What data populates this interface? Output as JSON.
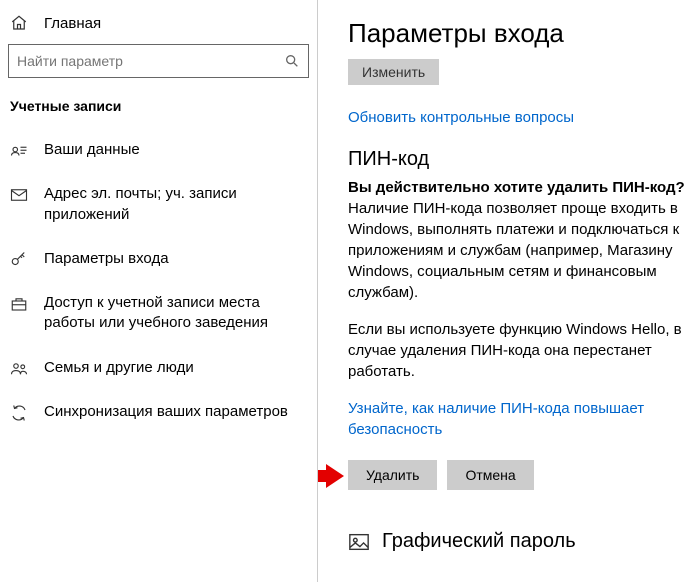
{
  "sidebar": {
    "home": "Главная",
    "search_placeholder": "Найти параметр",
    "section": "Учетные записи",
    "items": [
      {
        "label": "Ваши данные"
      },
      {
        "label": "Адрес эл. почты; уч. записи приложений"
      },
      {
        "label": "Параметры входа"
      },
      {
        "label": "Доступ к учетной записи места работы или учебного заведения"
      },
      {
        "label": "Семья и другие люди"
      },
      {
        "label": "Синхронизация ваших параметров"
      }
    ]
  },
  "main": {
    "title": "Параметры входа",
    "change_btn": "Изменить",
    "link_update_questions": "Обновить контрольные вопросы",
    "pin_section": "ПИН-код",
    "confirm_question": "Вы действительно хотите удалить ПИН-код?",
    "body1": "Наличие ПИН-кода позволяет проще входить в Windows, выполнять платежи и подключаться к приложениям и службам (например, Магазину Windows, социальным сетям и финансовым службам).",
    "body2": "Если вы используете функцию Windows Hello, в случае удаления ПИН-кода она перестанет работать.",
    "link_learn": "Узнайте, как наличие ПИН-кода повышает безопасность",
    "delete_btn": "Удалить",
    "cancel_btn": "Отмена",
    "picture_password": "Графический пароль"
  }
}
